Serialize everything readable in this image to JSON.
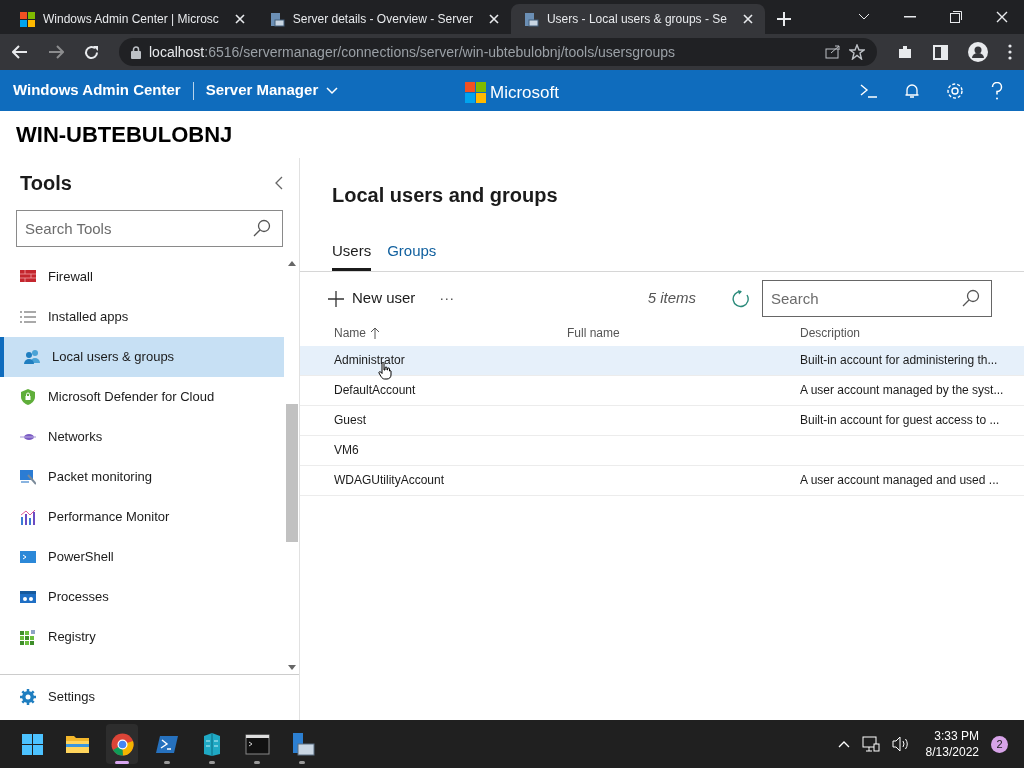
{
  "browser": {
    "tabs": [
      {
        "title": "Windows Admin Center | Microsc",
        "selected": false
      },
      {
        "title": "Server details - Overview - Server",
        "selected": false
      },
      {
        "title": "Users - Local users & groups - Se",
        "selected": true
      }
    ],
    "address": {
      "host": "localhost",
      "rest": ":6516/servermanager/connections/server/win-ubtebulobnj/tools/usersgroups"
    }
  },
  "header": {
    "app": "Windows Admin Center",
    "section": "Server Manager",
    "brand": "Microsoft"
  },
  "server_name": "WIN-UBTEBULOBNJ",
  "sidebar": {
    "title": "Tools",
    "search": {
      "placeholder": "Search Tools"
    },
    "items": [
      {
        "label": "Firewall",
        "selected": false
      },
      {
        "label": "Installed apps",
        "selected": false
      },
      {
        "label": "Local users & groups",
        "selected": true
      },
      {
        "label": "Microsoft Defender for Cloud",
        "selected": false
      },
      {
        "label": "Networks",
        "selected": false
      },
      {
        "label": "Packet monitoring",
        "selected": false
      },
      {
        "label": "Performance Monitor",
        "selected": false
      },
      {
        "label": "PowerShell",
        "selected": false
      },
      {
        "label": "Processes",
        "selected": false
      },
      {
        "label": "Registry",
        "selected": false
      }
    ],
    "settings": "Settings"
  },
  "page": {
    "title": "Local users and groups",
    "tabs": [
      {
        "label": "Users",
        "selected": true
      },
      {
        "label": "Groups",
        "selected": false
      }
    ],
    "toolbar": {
      "new": "New user",
      "more": "···",
      "count": "5 items",
      "search": {
        "placeholder": "Search"
      }
    },
    "table": {
      "columns": [
        "Name",
        "Full name",
        "Description"
      ],
      "rows": [
        {
          "cells": [
            "Administrator",
            "",
            "Built-in account for administering th..."
          ],
          "selected": true
        },
        {
          "cells": [
            "DefaultAccount",
            "",
            "A user account managed by the syst..."
          ],
          "selected": false
        },
        {
          "cells": [
            "Guest",
            "",
            "Built-in account for guest access to ..."
          ],
          "selected": false
        },
        {
          "cells": [
            "VM6",
            "",
            ""
          ],
          "selected": false
        },
        {
          "cells": [
            "WDAGUtilityAccount",
            "",
            "A user account managed and used ..."
          ],
          "selected": false
        }
      ]
    }
  },
  "taskbar": {
    "apps": [
      {
        "selected": false
      },
      {
        "selected": false
      },
      {
        "selected": true
      },
      {
        "selected": false
      },
      {
        "selected": false
      },
      {
        "selected": false
      },
      {
        "selected": false
      }
    ],
    "time": "3:33 PM",
    "date": "8/13/2022",
    "badge": "2"
  }
}
